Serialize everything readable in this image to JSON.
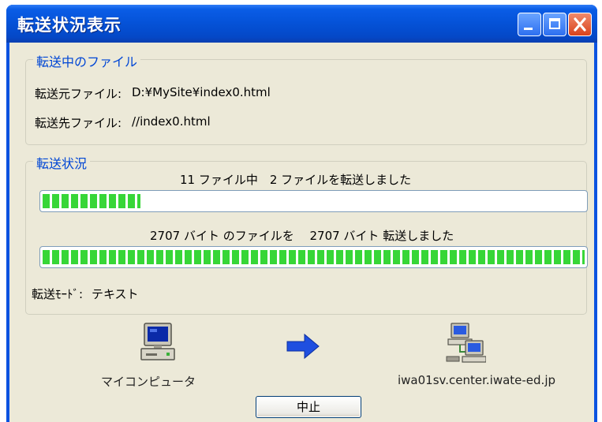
{
  "window": {
    "title": "転送状況表示"
  },
  "file_group": {
    "title": "転送中のファイル",
    "source_label": "転送元ファイル:",
    "source_value": "D:¥MySite¥index0.html",
    "dest_label": "転送先ファイル:",
    "dest_value": "//index0.html"
  },
  "status_group": {
    "title": "転送状況",
    "files_text": "11 ファイル中　2 ファイルを転送しました",
    "files_total": 11,
    "files_done": 2,
    "files_progress_fraction": 0.18,
    "bytes_text": "2707 バイト のファイルを　 2707 バイト 転送しました",
    "bytes_total": 2707,
    "bytes_done": 2707,
    "bytes_progress_fraction": 1.0,
    "mode_label": "転送ﾓｰﾄﾞ:",
    "mode_value": "テキスト"
  },
  "transfer": {
    "source_icon": "computer-icon",
    "source_name": "マイコンピュータ",
    "arrow_icon": "arrow-right-icon",
    "dest_icon": "network-server-icon",
    "dest_name": "iwa01sv.center.iwate-ed.jp"
  },
  "buttons": {
    "stop_label": "中止"
  },
  "colors": {
    "titlebar": "#0553d9",
    "group_title": "#0046d5",
    "progress_fill": "#37d637",
    "dialog_bg": "#ece9d8",
    "arrow": "#1f4fe0"
  }
}
